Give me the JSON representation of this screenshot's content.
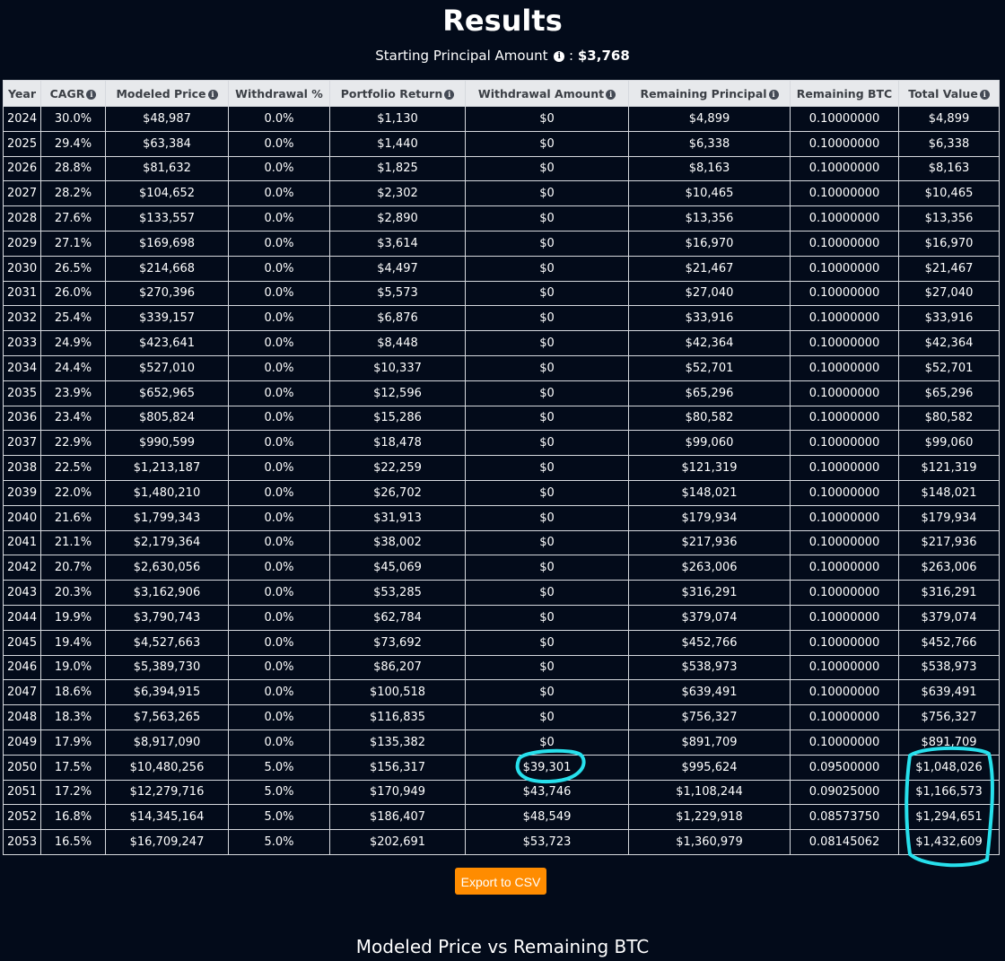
{
  "header": {
    "title": "Results",
    "principal_label": "Starting Principal Amount",
    "principal_sep": ":",
    "principal_value": "$3,768"
  },
  "table": {
    "columns": [
      {
        "label": "Year",
        "info": false
      },
      {
        "label": "CAGR",
        "info": true
      },
      {
        "label": "Modeled Price",
        "info": true
      },
      {
        "label": "Withdrawal %",
        "info": false
      },
      {
        "label": "Portfolio Return",
        "info": true
      },
      {
        "label": "Withdrawal Amount",
        "info": true
      },
      {
        "label": "Remaining Principal",
        "info": true
      },
      {
        "label": "Remaining BTC",
        "info": false
      },
      {
        "label": "Total Value",
        "info": true
      }
    ],
    "rows": [
      [
        "2024",
        "30.0%",
        "$48,987",
        "0.0%",
        "$1,130",
        "$0",
        "$4,899",
        "0.10000000",
        "$4,899"
      ],
      [
        "2025",
        "29.4%",
        "$63,384",
        "0.0%",
        "$1,440",
        "$0",
        "$6,338",
        "0.10000000",
        "$6,338"
      ],
      [
        "2026",
        "28.8%",
        "$81,632",
        "0.0%",
        "$1,825",
        "$0",
        "$8,163",
        "0.10000000",
        "$8,163"
      ],
      [
        "2027",
        "28.2%",
        "$104,652",
        "0.0%",
        "$2,302",
        "$0",
        "$10,465",
        "0.10000000",
        "$10,465"
      ],
      [
        "2028",
        "27.6%",
        "$133,557",
        "0.0%",
        "$2,890",
        "$0",
        "$13,356",
        "0.10000000",
        "$13,356"
      ],
      [
        "2029",
        "27.1%",
        "$169,698",
        "0.0%",
        "$3,614",
        "$0",
        "$16,970",
        "0.10000000",
        "$16,970"
      ],
      [
        "2030",
        "26.5%",
        "$214,668",
        "0.0%",
        "$4,497",
        "$0",
        "$21,467",
        "0.10000000",
        "$21,467"
      ],
      [
        "2031",
        "26.0%",
        "$270,396",
        "0.0%",
        "$5,573",
        "$0",
        "$27,040",
        "0.10000000",
        "$27,040"
      ],
      [
        "2032",
        "25.4%",
        "$339,157",
        "0.0%",
        "$6,876",
        "$0",
        "$33,916",
        "0.10000000",
        "$33,916"
      ],
      [
        "2033",
        "24.9%",
        "$423,641",
        "0.0%",
        "$8,448",
        "$0",
        "$42,364",
        "0.10000000",
        "$42,364"
      ],
      [
        "2034",
        "24.4%",
        "$527,010",
        "0.0%",
        "$10,337",
        "$0",
        "$52,701",
        "0.10000000",
        "$52,701"
      ],
      [
        "2035",
        "23.9%",
        "$652,965",
        "0.0%",
        "$12,596",
        "$0",
        "$65,296",
        "0.10000000",
        "$65,296"
      ],
      [
        "2036",
        "23.4%",
        "$805,824",
        "0.0%",
        "$15,286",
        "$0",
        "$80,582",
        "0.10000000",
        "$80,582"
      ],
      [
        "2037",
        "22.9%",
        "$990,599",
        "0.0%",
        "$18,478",
        "$0",
        "$99,060",
        "0.10000000",
        "$99,060"
      ],
      [
        "2038",
        "22.5%",
        "$1,213,187",
        "0.0%",
        "$22,259",
        "$0",
        "$121,319",
        "0.10000000",
        "$121,319"
      ],
      [
        "2039",
        "22.0%",
        "$1,480,210",
        "0.0%",
        "$26,702",
        "$0",
        "$148,021",
        "0.10000000",
        "$148,021"
      ],
      [
        "2040",
        "21.6%",
        "$1,799,343",
        "0.0%",
        "$31,913",
        "$0",
        "$179,934",
        "0.10000000",
        "$179,934"
      ],
      [
        "2041",
        "21.1%",
        "$2,179,364",
        "0.0%",
        "$38,002",
        "$0",
        "$217,936",
        "0.10000000",
        "$217,936"
      ],
      [
        "2042",
        "20.7%",
        "$2,630,056",
        "0.0%",
        "$45,069",
        "$0",
        "$263,006",
        "0.10000000",
        "$263,006"
      ],
      [
        "2043",
        "20.3%",
        "$3,162,906",
        "0.0%",
        "$53,285",
        "$0",
        "$316,291",
        "0.10000000",
        "$316,291"
      ],
      [
        "2044",
        "19.9%",
        "$3,790,743",
        "0.0%",
        "$62,784",
        "$0",
        "$379,074",
        "0.10000000",
        "$379,074"
      ],
      [
        "2045",
        "19.4%",
        "$4,527,663",
        "0.0%",
        "$73,692",
        "$0",
        "$452,766",
        "0.10000000",
        "$452,766"
      ],
      [
        "2046",
        "19.0%",
        "$5,389,730",
        "0.0%",
        "$86,207",
        "$0",
        "$538,973",
        "0.10000000",
        "$538,973"
      ],
      [
        "2047",
        "18.6%",
        "$6,394,915",
        "0.0%",
        "$100,518",
        "$0",
        "$639,491",
        "0.10000000",
        "$639,491"
      ],
      [
        "2048",
        "18.3%",
        "$7,563,265",
        "0.0%",
        "$116,835",
        "$0",
        "$756,327",
        "0.10000000",
        "$756,327"
      ],
      [
        "2049",
        "17.9%",
        "$8,917,090",
        "0.0%",
        "$135,382",
        "$0",
        "$891,709",
        "0.10000000",
        "$891,709"
      ],
      [
        "2050",
        "17.5%",
        "$10,480,256",
        "5.0%",
        "$156,317",
        "$39,301",
        "$995,624",
        "0.09500000",
        "$1,048,026"
      ],
      [
        "2051",
        "17.2%",
        "$12,279,716",
        "5.0%",
        "$170,949",
        "$43,746",
        "$1,108,244",
        "0.09025000",
        "$1,166,573"
      ],
      [
        "2052",
        "16.8%",
        "$14,345,164",
        "5.0%",
        "$186,407",
        "$48,549",
        "$1,229,918",
        "0.08573750",
        "$1,294,651"
      ],
      [
        "2053",
        "16.5%",
        "$16,709,247",
        "5.0%",
        "$202,691",
        "$53,723",
        "$1,360,979",
        "0.08145062",
        "$1,432,609"
      ]
    ]
  },
  "export_button": {
    "label": "Export to CSV"
  },
  "chart_section": {
    "title": "Modeled Price vs Remaining BTC"
  },
  "colors": {
    "background": "#030b1a",
    "header_bg": "#e7e9ec",
    "button": "#ff8c00",
    "annotation": "#27e0ec"
  },
  "icons": {
    "info": "info-circle-icon"
  }
}
